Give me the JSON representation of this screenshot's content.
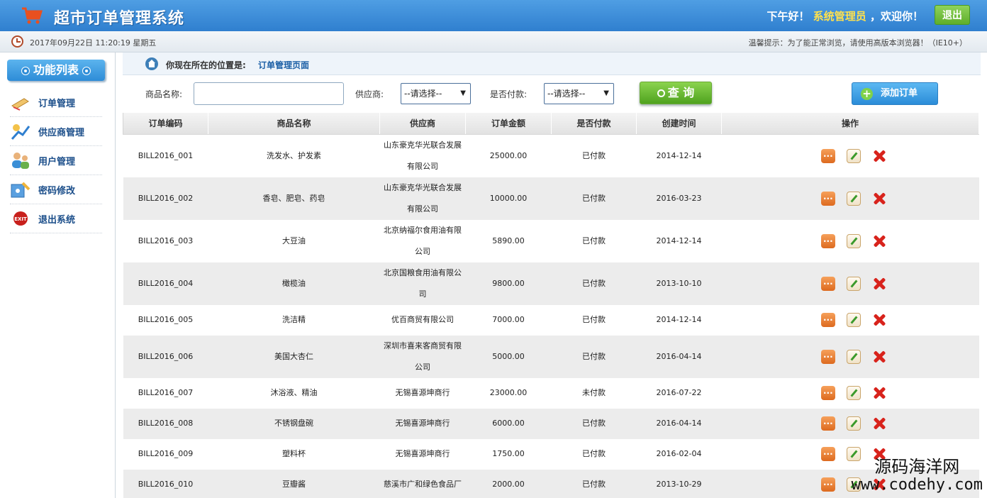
{
  "header": {
    "title": "超市订单管理系统",
    "greeting_prefix": "下午好！",
    "username": "系统管理员",
    "greeting_suffix": "，欢迎你！",
    "logout_label": "退出"
  },
  "subbar": {
    "datetime": "2017年09月22日 11:20:19 星期五",
    "notice": "温馨提示：为了能正常浏览，请使用高版本浏览器！（IE10+）"
  },
  "sidebar": {
    "title": "功能列表",
    "items": [
      {
        "label": "订单管理",
        "icon": "order-icon"
      },
      {
        "label": "供应商管理",
        "icon": "provider-icon"
      },
      {
        "label": "用户管理",
        "icon": "users-icon"
      },
      {
        "label": "密码修改",
        "icon": "password-icon"
      },
      {
        "label": "退出系统",
        "icon": "exit-icon"
      }
    ]
  },
  "location": {
    "label": "你现在所在的位置是:",
    "value": "订单管理页面"
  },
  "search": {
    "product_label": "商品名称:",
    "product_value": "",
    "provider_label": "供应商:",
    "provider_selected": "--请选择--",
    "paid_label": "是否付款:",
    "paid_selected": "--请选择--",
    "query_label": "查 询",
    "add_label": "添加订单"
  },
  "table": {
    "headers": [
      "订单编码",
      "商品名称",
      "供应商",
      "订单金额",
      "是否付款",
      "创建时间",
      "操作"
    ],
    "rows": [
      {
        "code": "BILL2016_001",
        "product": "洗发水、护发素",
        "provider_1": "山东豪克华光联合发展",
        "provider_2": "有限公司",
        "amount": "25000.00",
        "paid": "已付款",
        "date": "2014-12-14"
      },
      {
        "code": "BILL2016_002",
        "product": "香皂、肥皂、药皂",
        "provider_1": "山东豪克华光联合发展",
        "provider_2": "有限公司",
        "amount": "10000.00",
        "paid": "已付款",
        "date": "2016-03-23"
      },
      {
        "code": "BILL2016_003",
        "product": "大豆油",
        "provider_1": "北京纳福尔食用油有限",
        "provider_2": "公司",
        "amount": "5890.00",
        "paid": "已付款",
        "date": "2014-12-14"
      },
      {
        "code": "BILL2016_004",
        "product": "橄榄油",
        "provider_1": "北京国粮食用油有限公",
        "provider_2": "司",
        "amount": "9800.00",
        "paid": "已付款",
        "date": "2013-10-10"
      },
      {
        "code": "BILL2016_005",
        "product": "洗洁精",
        "provider_1": "优百商贸有限公司",
        "provider_2": "",
        "amount": "7000.00",
        "paid": "已付款",
        "date": "2014-12-14"
      },
      {
        "code": "BILL2016_006",
        "product": "美国大杏仁",
        "provider_1": "深圳市喜来客商贸有限",
        "provider_2": "公司",
        "amount": "5000.00",
        "paid": "已付款",
        "date": "2016-04-14"
      },
      {
        "code": "BILL2016_007",
        "product": "沐浴液、精油",
        "provider_1": "无锡喜源坤商行",
        "provider_2": "",
        "amount": "23000.00",
        "paid": "未付款",
        "date": "2016-07-22"
      },
      {
        "code": "BILL2016_008",
        "product": "不锈钢盘碗",
        "provider_1": "无锡喜源坤商行",
        "provider_2": "",
        "amount": "6000.00",
        "paid": "已付款",
        "date": "2016-04-14"
      },
      {
        "code": "BILL2016_009",
        "product": "塑料杯",
        "provider_1": "无锡喜源坤商行",
        "provider_2": "",
        "amount": "1750.00",
        "paid": "已付款",
        "date": "2016-02-04"
      },
      {
        "code": "BILL2016_010",
        "product": "豆瓣酱",
        "provider_1": "慈溪市广和绿色食品厂",
        "provider_2": "",
        "amount": "2000.00",
        "paid": "已付款",
        "date": "2013-10-29"
      }
    ]
  },
  "watermark": {
    "cn": "源码海洋网",
    "url": "www.codehy.com"
  },
  "colors": {
    "header_blue": "#2f7fcf",
    "menu_text": "#1b4e8a",
    "query_green": "#4fa31f",
    "delete_red": "#d8231c"
  }
}
